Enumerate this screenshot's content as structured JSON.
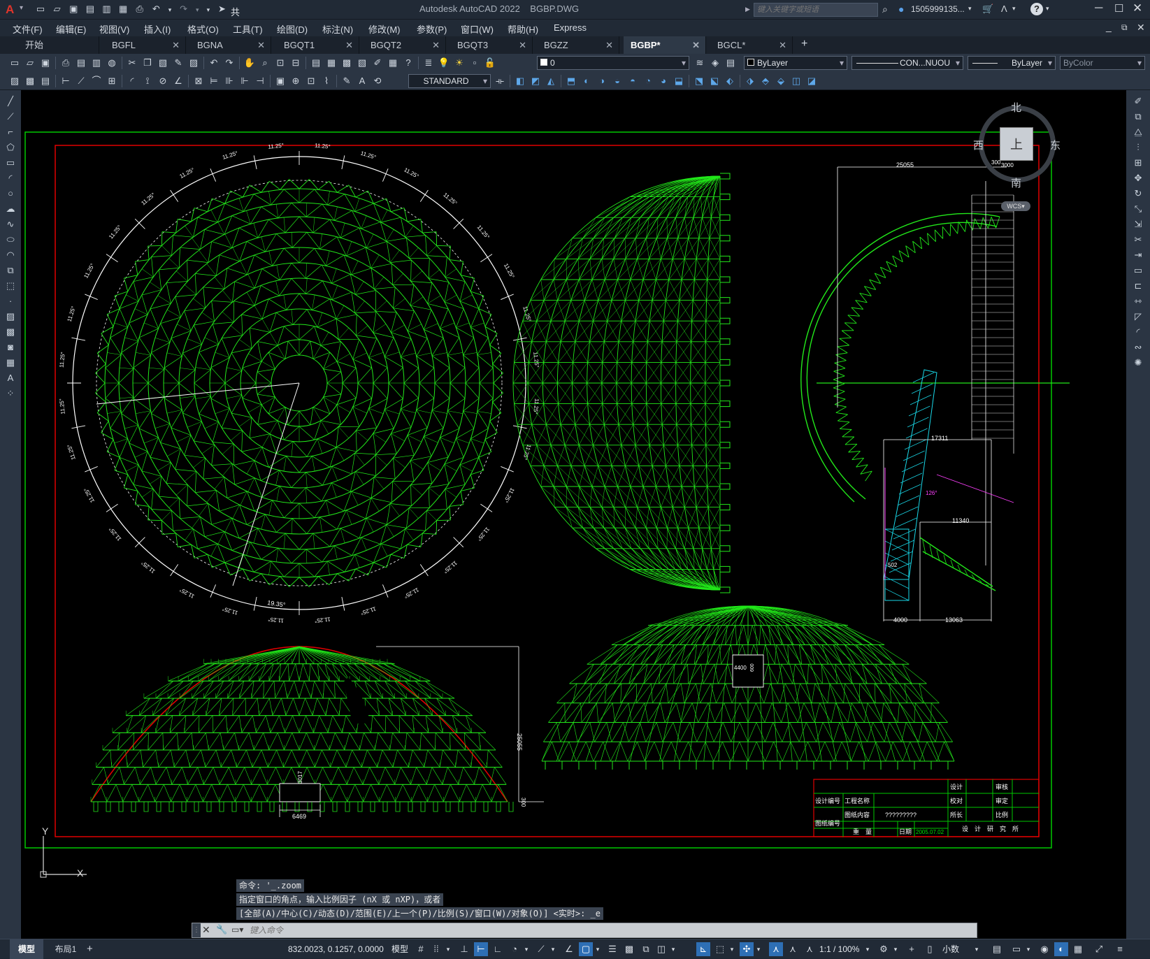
{
  "app": {
    "title": "Autodesk AutoCAD 2022",
    "file": "BGBP.DWG",
    "share": "共享",
    "search_placeholder": "键入关键字或短语",
    "user": "1505999135...",
    "window_controls": [
      "minimize-icon",
      "maximize-icon",
      "close-icon"
    ]
  },
  "menu": [
    "文件(F)",
    "编辑(E)",
    "视图(V)",
    "插入(I)",
    "格式(O)",
    "工具(T)",
    "绘图(D)",
    "标注(N)",
    "修改(M)",
    "参数(P)",
    "窗口(W)",
    "帮助(H)",
    "Express"
  ],
  "tabs": [
    {
      "label": "开始",
      "active": false,
      "closable": false
    },
    {
      "label": "BGFL",
      "active": false,
      "closable": true
    },
    {
      "label": "BGNA",
      "active": false,
      "closable": true
    },
    {
      "label": "BGQT1",
      "active": false,
      "closable": true
    },
    {
      "label": "BGQT2",
      "active": false,
      "closable": true
    },
    {
      "label": "BGQT3",
      "active": false,
      "closable": true
    },
    {
      "label": "BGZZ",
      "active": false,
      "closable": true
    },
    {
      "label": "BGBP*",
      "active": true,
      "closable": true
    },
    {
      "label": "BGCL*",
      "active": false,
      "closable": true
    }
  ],
  "toolbar": {
    "layer_value": "0",
    "color_value": "ByLayer",
    "linetype_value": "CON...NUOU",
    "lineweight_value": "ByLayer",
    "plotstyle_value": "ByColor",
    "textstyle_value": "STANDARD"
  },
  "viewcube": {
    "north": "北",
    "south": "南",
    "east": "东",
    "west": "西",
    "top": "上",
    "wcs": "WCS"
  },
  "drawing": {
    "angle_label": "11.25°",
    "angle_label_19": "19.35°",
    "dims": {
      "d25055_top": "25055",
      "d300": "300",
      "d3000": "3000",
      "d17311": "17311",
      "d11340": "11340",
      "d4000": "4000",
      "d13063": "13063",
      "d502": "502",
      "d126": "126°",
      "d25055_side": "25055",
      "d300_bottom": "300",
      "d3017": "3017",
      "d6469": "6469",
      "d4400": "4400",
      "d600": "600"
    },
    "title_block": {
      "sheji": "设计",
      "jiaodui": "校对",
      "suozhang": "所长",
      "shenhe": "审核",
      "shending": "审定",
      "bili": "比例",
      "sheji_bianhao": "设计编号",
      "gongcheng_mingcheng": "工程名称",
      "tuzhi_neirong": "图纸内容",
      "content_value": "?????????",
      "tuzhi_bianhao": "图纸编号",
      "chongliang": "重　量",
      "riqi": "日期",
      "riqi_value": "2005.07.02",
      "institute": "设　计　研　究　所"
    }
  },
  "command": {
    "history": [
      "命令: '_.zoom",
      "指定窗口的角点，输入比例因子 (nX 或 nXP)，或者",
      "[全部(A)/中心(C)/动态(D)/范围(E)/上一个(P)/比例(S)/窗口(W)/对象(O)] <实时>: _e"
    ],
    "input_placeholder": "键入命令"
  },
  "ucs": {
    "x": "X",
    "y": "Y"
  },
  "status": {
    "tab_model": "模型",
    "tab_layout": "布局1",
    "coords": "832.0023, 0.1257, 0.0000",
    "space": "模型",
    "scale": "1:1 / 100%",
    "units": "小数"
  }
}
